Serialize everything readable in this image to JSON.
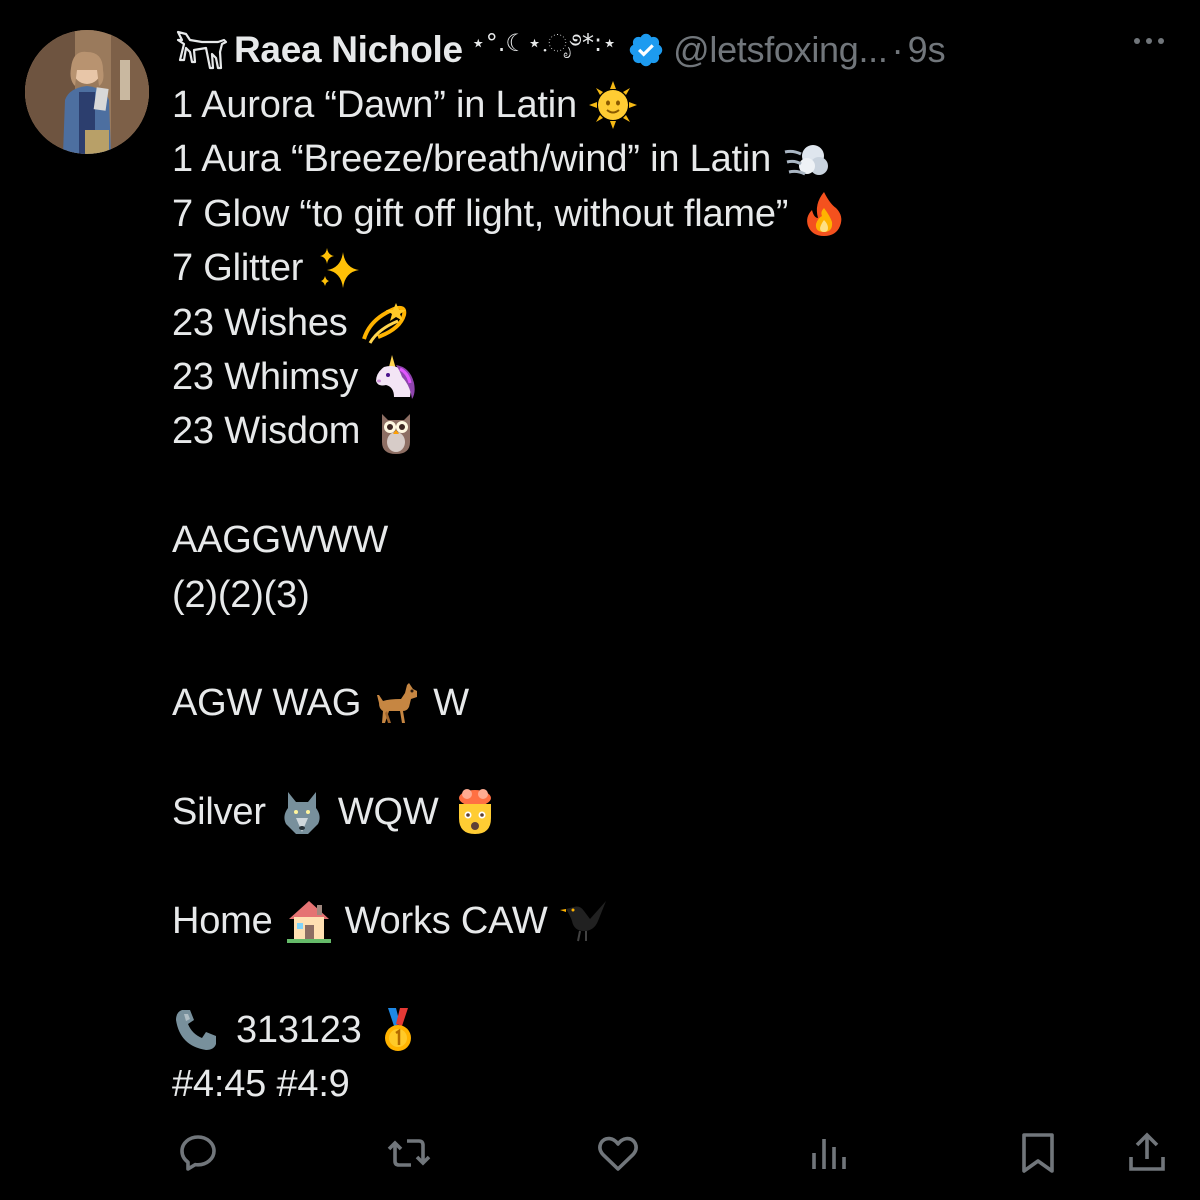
{
  "author": {
    "display_name": "Raea Nichole",
    "name_decoration": "⋆°.☾⋆.ೃ࿔*:⋆",
    "handle": "@letsfoxing...",
    "separator": "·",
    "time": "9s",
    "verified": true
  },
  "tweet": {
    "lines": [
      {
        "text": "1 Aurora “Dawn” in Latin",
        "emoji": "sun-with-face-icon"
      },
      {
        "text": "1 Aura “Breeze/breath/wind” in Latin",
        "emoji": "dash-wind-icon"
      },
      {
        "text": "7 Glow “to gift off light, without flame”",
        "emoji": "fire-icon"
      },
      {
        "text": "7 Glitter",
        "emoji": "sparkles-icon"
      },
      {
        "text": "23 Wishes",
        "emoji": "dizzy-star-icon"
      },
      {
        "text": "23 Whimsy",
        "emoji": "unicorn-icon"
      },
      {
        "text": "23 Wisdom",
        "emoji": "owl-icon"
      },
      {
        "text": "AAGGWWW"
      },
      {
        "text": "(2)(2)(3)"
      },
      {
        "text": "AGW WAG",
        "emoji": "dog-icon",
        "after": "W"
      },
      {
        "text": "Silver",
        "emoji": "wolf-icon",
        "after": "WQW"
      },
      {
        "text": "Home",
        "emoji": "house-icon",
        "after": "Works CAW"
      },
      {
        "lead_emoji": "telephone-icon",
        "text": "313123",
        "emoji": "medal-icon"
      },
      {
        "text": "#4:45 #4:9"
      }
    ]
  },
  "actions": [
    "reply-icon",
    "retweet-icon",
    "like-icon",
    "views-icon",
    "bookmark-icon",
    "share-icon"
  ],
  "colors": {
    "background": "#000000",
    "text": "#e7e9ea",
    "muted": "#71767b",
    "verified": "#1d9bf0"
  }
}
